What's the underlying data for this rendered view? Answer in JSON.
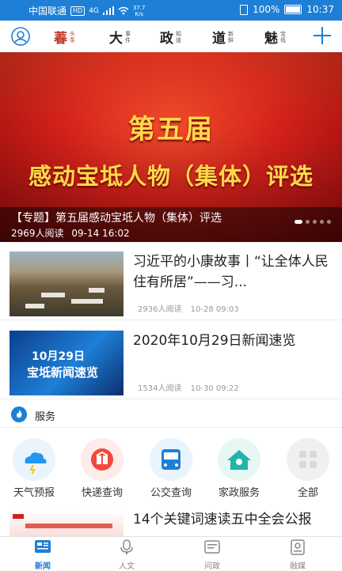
{
  "status_bar": {
    "carrier": "中国联通",
    "hd": "HD",
    "signal": "4G",
    "speed_value": "37.7",
    "speed_unit": "K/s",
    "battery": "100%",
    "time": "10:37"
  },
  "top_nav": {
    "items": [
      {
        "char": "萶",
        "sub": "头条",
        "active": true
      },
      {
        "char": "大",
        "sub": "事件",
        "active": false
      },
      {
        "char": "政",
        "sub": "知道",
        "active": false
      },
      {
        "char": "道",
        "sub": "新鲜",
        "active": false
      },
      {
        "char": "魅",
        "sub": "宝坻",
        "active": false
      }
    ]
  },
  "banner": {
    "headline_line1": "第五届",
    "headline_line2": "感动宝坻人物（集体）评选",
    "caption_title": "【专题】第五届感动宝坻人物（集体）评选",
    "caption_reads": "2969人阅读",
    "caption_time": "09-14 16:02",
    "dot_count": 5,
    "active_dot": 0
  },
  "news": [
    {
      "title": "习近平的小康故事丨“让全体人民住有所居”——习...",
      "reads": "2936人阅读",
      "time": "10-28 09:03",
      "thumb": "landscape-village"
    },
    {
      "title": "2020年10月29日新闻速览",
      "reads": "1534人阅读",
      "time": "10-30 09:22",
      "thumb_line1": "10月29日",
      "thumb_line2": "宝坻新闻速览"
    }
  ],
  "services_section": {
    "title": "服务",
    "items": [
      {
        "label": "天气预报",
        "icon": "weather-icon",
        "color": "#2196f3"
      },
      {
        "label": "快递查询",
        "icon": "express-icon",
        "color": "#f04a3a"
      },
      {
        "label": "公交查询",
        "icon": "bus-icon",
        "color": "#1e7fd6"
      },
      {
        "label": "家政服务",
        "icon": "home-service-icon",
        "color": "#1fb5a8"
      },
      {
        "label": "全部",
        "icon": "all-icon",
        "color": "#d9d9d9"
      }
    ]
  },
  "bottom_news": {
    "title": "14个关键词速读五中全会公报"
  },
  "tabbar": {
    "items": [
      {
        "label": "新闻",
        "icon": "news-icon",
        "active": true
      },
      {
        "label": "人文",
        "icon": "microphone-icon",
        "active": false
      },
      {
        "label": "问政",
        "icon": "inquiry-icon",
        "active": false
      },
      {
        "label": "融媒",
        "icon": "media-icon",
        "active": false
      }
    ]
  },
  "colors": {
    "brand_blue": "#1e7fd6",
    "nav_active_red": "#c0392b",
    "banner_text_gold": "#ffd94a"
  }
}
